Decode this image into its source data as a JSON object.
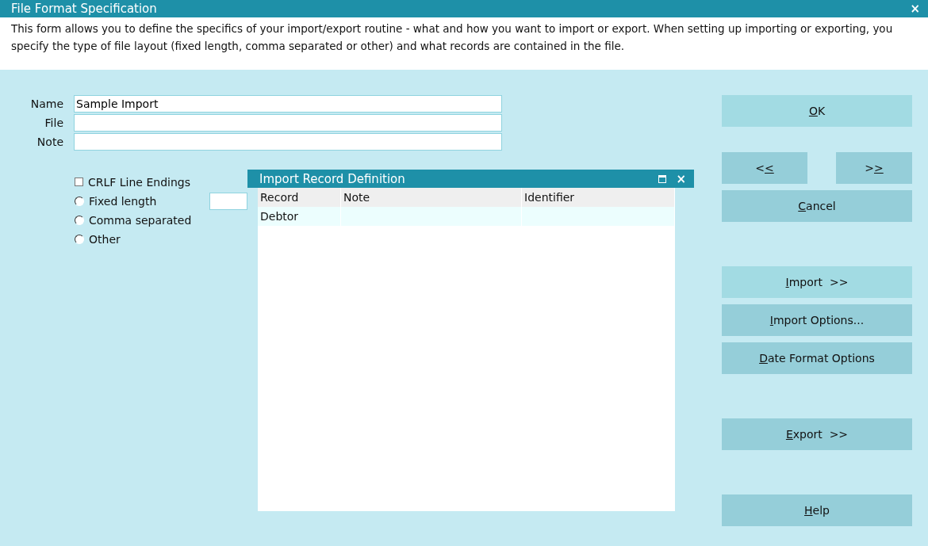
{
  "window": {
    "title": "File Format Specification",
    "close": "×"
  },
  "description": "This form allows you to define the specifics of your import/export routine - what and how you want to import or export. When setting up importing or exporting, you specify the type of file layout (fixed length, comma separated or other) and what records are contained in the file.",
  "fields": [
    {
      "label": "Name",
      "value": "Sample Import"
    },
    {
      "label": "File"
    },
    {
      "label": "Note"
    }
  ],
  "options": [
    {
      "kind": "checkbox",
      "label": "CRLF Line Endings",
      "checked": false
    },
    {
      "kind": "radio",
      "label": "Fixed length",
      "selected": false,
      "length_field": true
    },
    {
      "kind": "radio",
      "label": "Comma separated",
      "selected": false
    },
    {
      "kind": "radio",
      "label": "Other",
      "selected": false
    }
  ],
  "record_window": {
    "title": "Import Record Definition",
    "close": "×",
    "columns": [
      "Record",
      "Note",
      "Identifier"
    ],
    "rows": [
      [
        "Debtor",
        null,
        null
      ]
    ]
  },
  "buttons": [
    {
      "kind": "full",
      "key": "O",
      "after": "K",
      "highlighted": true
    },
    {
      "kind": "half",
      "before": "<",
      "key": "<",
      "highlighted": false
    },
    {
      "kind": "half",
      "before": ">",
      "key": ">",
      "highlighted": false
    },
    {
      "kind": "full",
      "key": "C",
      "after": "ancel",
      "highlighted": false
    },
    {
      "kind": "full",
      "key": "I",
      "after": "mport  >>",
      "highlighted": true
    },
    {
      "kind": "full",
      "key": "I",
      "after": "mport Options...",
      "highlighted": false
    },
    {
      "kind": "full",
      "key": "D",
      "after": "ate Format Options",
      "highlighted": false
    },
    {
      "kind": "full",
      "key": "E",
      "after": "xport  >>",
      "highlighted": false
    },
    {
      "kind": "full",
      "key": "H",
      "after": "elp",
      "highlighted": false
    }
  ]
}
